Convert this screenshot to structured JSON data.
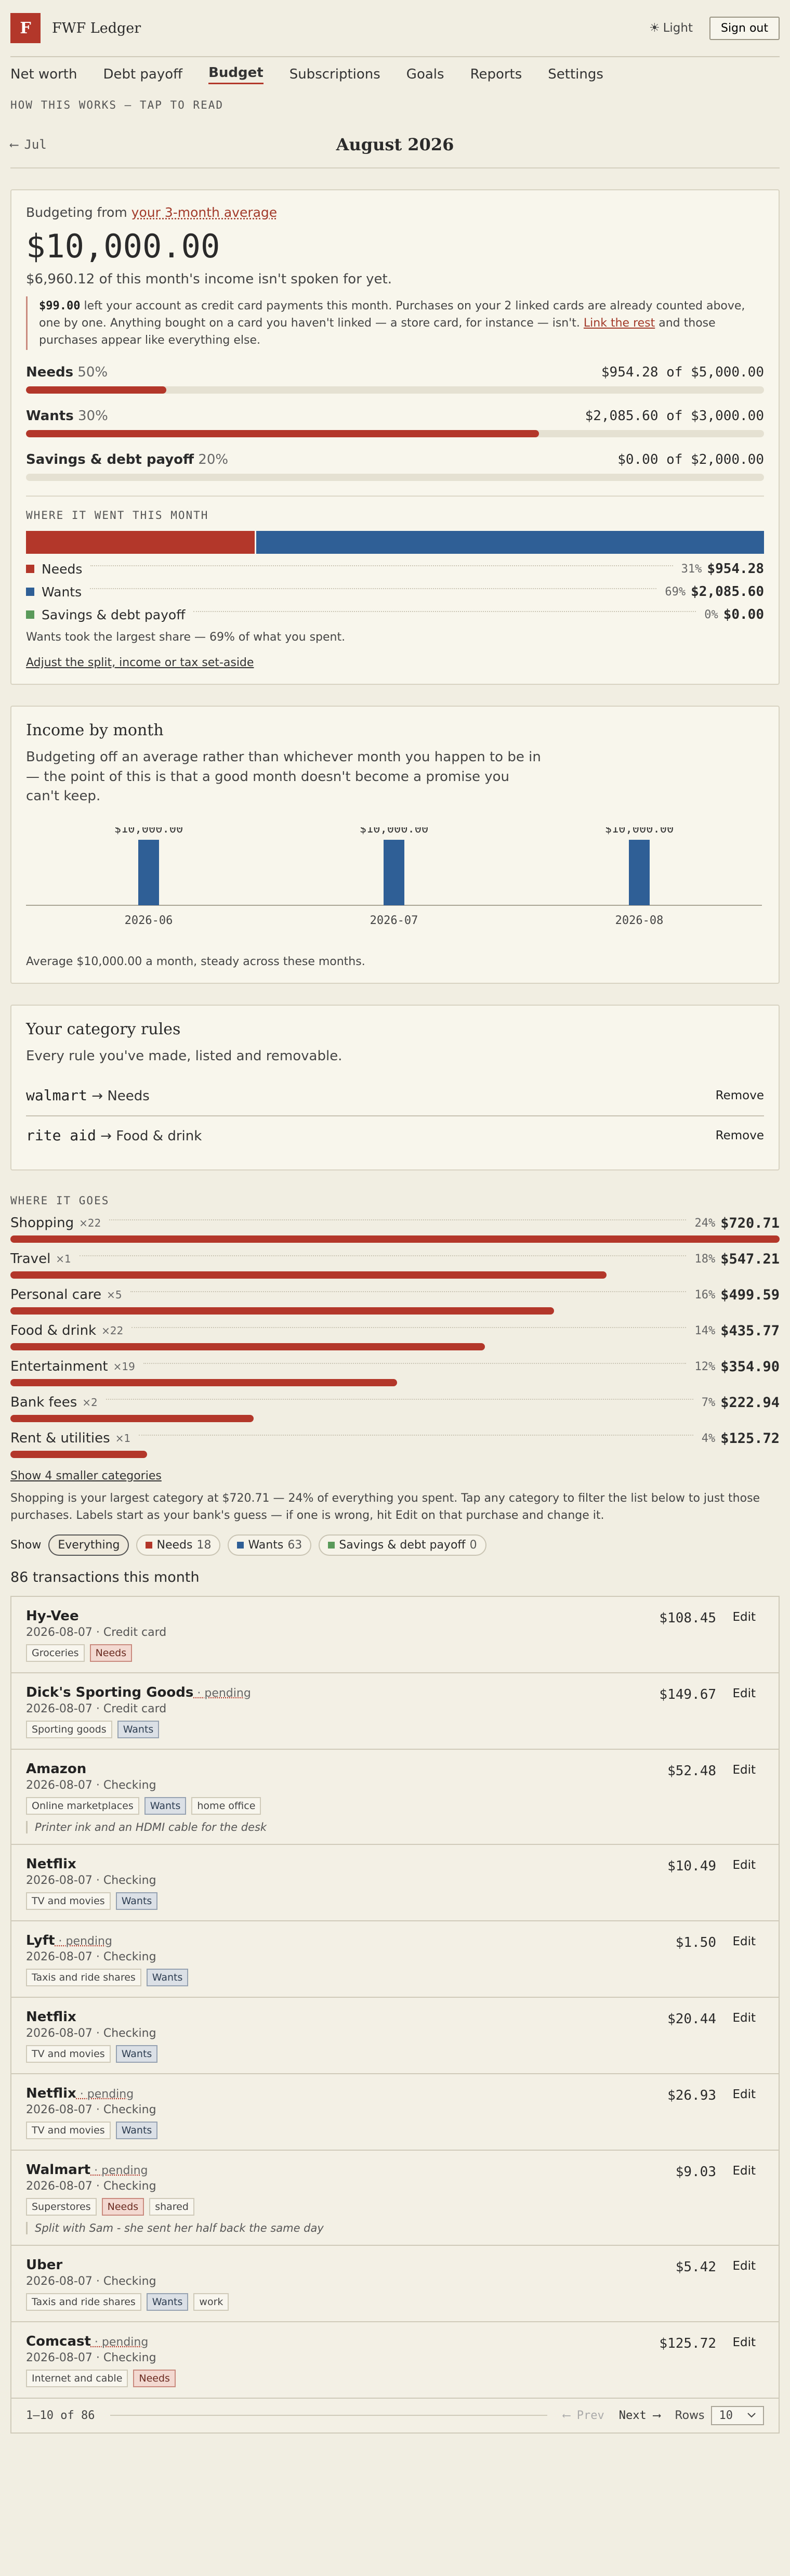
{
  "app": {
    "logo_letter": "F",
    "name": "FWF Ledger",
    "theme_label": "Light",
    "theme_icon": "☀",
    "sign_out": "Sign out"
  },
  "nav": [
    "Net worth",
    "Debt payoff",
    "Budget",
    "Subscriptions",
    "Goals",
    "Reports",
    "Settings"
  ],
  "nav_active": "Budget",
  "how_this_works": "HOW THIS WORKS — TAP TO READ",
  "month": {
    "prev": "Jul",
    "prev_arrow": "⟵",
    "title": "August 2026"
  },
  "summary": {
    "budget_prefix": "Budgeting from ",
    "budget_link": "your 3-month average",
    "amount": "$10,000.00",
    "unspoken": "$6,960.12 of this month's income isn't spoken for yet.",
    "note_amount": "$99.00",
    "note_text": " left your account as credit card payments this month. Purchases on your 2 linked cards are already counted above, one by one. Anything bought on a card you haven't linked — a store card, for instance — isn't. ",
    "note_link": "Link the rest",
    "note_tail": " and those purchases appear like everything else."
  },
  "buckets": [
    {
      "name": "Needs",
      "pct": "50%",
      "spent": "$954.28",
      "of": "of",
      "limit": "$5,000.00",
      "fill": 0.19
    },
    {
      "name": "Wants",
      "pct": "30%",
      "spent": "$2,085.60",
      "of": "of",
      "limit": "$3,000.00",
      "fill": 0.695
    },
    {
      "name": "Savings & debt payoff",
      "pct": "20%",
      "spent": "$0.00",
      "of": "of",
      "limit": "$2,000.00",
      "fill": 0
    }
  ],
  "where_it_went": {
    "heading": "WHERE IT WENT THIS MONTH",
    "items": [
      {
        "name": "Needs",
        "pct": "31%",
        "amount": "$954.28",
        "share": 0.31,
        "color": "#b3372a"
      },
      {
        "name": "Wants",
        "pct": "69%",
        "amount": "$2,085.60",
        "share": 0.69,
        "color": "#2f5f96"
      },
      {
        "name": "Savings & debt payoff",
        "pct": "0%",
        "amount": "$0.00",
        "share": 0,
        "color": "#5a9a5a"
      }
    ],
    "summary": "Wants took the largest share — 69% of what you spent.",
    "adjust_link": "Adjust the split, income or tax set-aside"
  },
  "income": {
    "title": "Income by month",
    "subtitle": "Budgeting off an average rather than whichever month you happen to be in — the point of this is that a good month doesn't become a promise you can't keep.",
    "footer": "Average $10,000.00 a month, steady across these months."
  },
  "chart_data": {
    "type": "bar",
    "categories": [
      "2026-06",
      "2026-07",
      "2026-08"
    ],
    "values": [
      10000,
      10000,
      10000
    ],
    "labels": [
      "$10,000.00",
      "$10,000.00",
      "$10,000.00"
    ],
    "ylim": [
      0,
      10000
    ],
    "color": "#2f5f96"
  },
  "rules": {
    "title": "Your category rules",
    "subtitle": "Every rule you've made, listed and removable.",
    "arrow": "→",
    "remove_label": "Remove",
    "items": [
      {
        "match": "walmart",
        "target": "Needs"
      },
      {
        "match": "rite aid",
        "target": "Food & drink"
      }
    ]
  },
  "where_it_goes": {
    "heading": "WHERE IT GOES",
    "categories": [
      {
        "name": "Shopping",
        "count": "×22",
        "pct": "24%",
        "amount": "$720.71",
        "fill": 1.0
      },
      {
        "name": "Travel",
        "count": "×1",
        "pct": "18%",
        "amount": "$547.21",
        "fill": 0.775
      },
      {
        "name": "Personal care",
        "count": "×5",
        "pct": "16%",
        "amount": "$499.59",
        "fill": 0.707
      },
      {
        "name": "Food & drink",
        "count": "×22",
        "pct": "14%",
        "amount": "$435.77",
        "fill": 0.617
      },
      {
        "name": "Entertainment",
        "count": "×19",
        "pct": "12%",
        "amount": "$354.90",
        "fill": 0.503
      },
      {
        "name": "Bank fees",
        "count": "×2",
        "pct": "7%",
        "amount": "$222.94",
        "fill": 0.316
      },
      {
        "name": "Rent & utilities",
        "count": "×1",
        "pct": "4%",
        "amount": "$125.72",
        "fill": 0.178
      }
    ],
    "show_smaller": "Show 4 smaller categories",
    "description": "Shopping is your largest category at $720.71 — 24% of everything you spent. Tap any category to filter the list below to just those purchases. Labels start as your bank's guess — if one is wrong, hit Edit on that purchase and change it."
  },
  "filters": {
    "label": "Show",
    "items": [
      {
        "name": "Everything",
        "count": "",
        "color": "",
        "active": true
      },
      {
        "name": "Needs",
        "count": "18",
        "color": "#b3372a",
        "active": false
      },
      {
        "name": "Wants",
        "count": "63",
        "color": "#2f5f96",
        "active": false
      },
      {
        "name": "Savings & debt payoff",
        "count": "0",
        "color": "#5a9a5a",
        "active": false
      }
    ]
  },
  "transactions_count": "86 transactions this month",
  "edit_label": "Edit",
  "pending_label": "pending",
  "transactions": [
    {
      "name": "Hy-Vee",
      "pending": false,
      "meta": "2026-08-07 · Credit card",
      "amount": "$108.45",
      "tags": [
        [
          "Groceries",
          ""
        ],
        [
          "Needs",
          "needs"
        ]
      ],
      "note": ""
    },
    {
      "name": "Dick's Sporting Goods",
      "pending": true,
      "meta": "2026-08-07 · Credit card",
      "amount": "$149.67",
      "tags": [
        [
          "Sporting goods",
          ""
        ],
        [
          "Wants",
          "wants"
        ]
      ],
      "note": ""
    },
    {
      "name": "Amazon",
      "pending": false,
      "meta": "2026-08-07 · Checking",
      "amount": "$52.48",
      "tags": [
        [
          "Online marketplaces",
          ""
        ],
        [
          "Wants",
          "wants"
        ],
        [
          "home office",
          ""
        ]
      ],
      "note": "Printer ink and an HDMI cable for the desk"
    },
    {
      "name": "Netflix",
      "pending": false,
      "meta": "2026-08-07 · Checking",
      "amount": "$10.49",
      "tags": [
        [
          "TV and movies",
          ""
        ],
        [
          "Wants",
          "wants"
        ]
      ],
      "note": ""
    },
    {
      "name": "Lyft",
      "pending": true,
      "meta": "2026-08-07 · Checking",
      "amount": "$1.50",
      "tags": [
        [
          "Taxis and ride shares",
          ""
        ],
        [
          "Wants",
          "wants"
        ]
      ],
      "note": ""
    },
    {
      "name": "Netflix",
      "pending": false,
      "meta": "2026-08-07 · Checking",
      "amount": "$20.44",
      "tags": [
        [
          "TV and movies",
          ""
        ],
        [
          "Wants",
          "wants"
        ]
      ],
      "note": ""
    },
    {
      "name": "Netflix",
      "pending": true,
      "meta": "2026-08-07 · Checking",
      "amount": "$26.93",
      "tags": [
        [
          "TV and movies",
          ""
        ],
        [
          "Wants",
          "wants"
        ]
      ],
      "note": ""
    },
    {
      "name": "Walmart",
      "pending": true,
      "meta": "2026-08-07 · Checking",
      "amount": "$9.03",
      "tags": [
        [
          "Superstores",
          ""
        ],
        [
          "Needs",
          "needs"
        ],
        [
          "shared",
          ""
        ]
      ],
      "note": "Split with Sam - she sent her half back the same day"
    },
    {
      "name": "Uber",
      "pending": false,
      "meta": "2026-08-07 · Checking",
      "amount": "$5.42",
      "tags": [
        [
          "Taxis and ride shares",
          ""
        ],
        [
          "Wants",
          "wants"
        ],
        [
          "work",
          ""
        ]
      ],
      "note": ""
    },
    {
      "name": "Comcast",
      "pending": true,
      "meta": "2026-08-07 · Checking",
      "amount": "$125.72",
      "tags": [
        [
          "Internet and cable",
          ""
        ],
        [
          "Needs",
          "needs"
        ]
      ],
      "note": ""
    }
  ],
  "pager": {
    "range": "1–10 of 86",
    "prev": "⟵ Prev",
    "next": "Next ⟶",
    "rows_label": "Rows",
    "rows_value": "10"
  }
}
